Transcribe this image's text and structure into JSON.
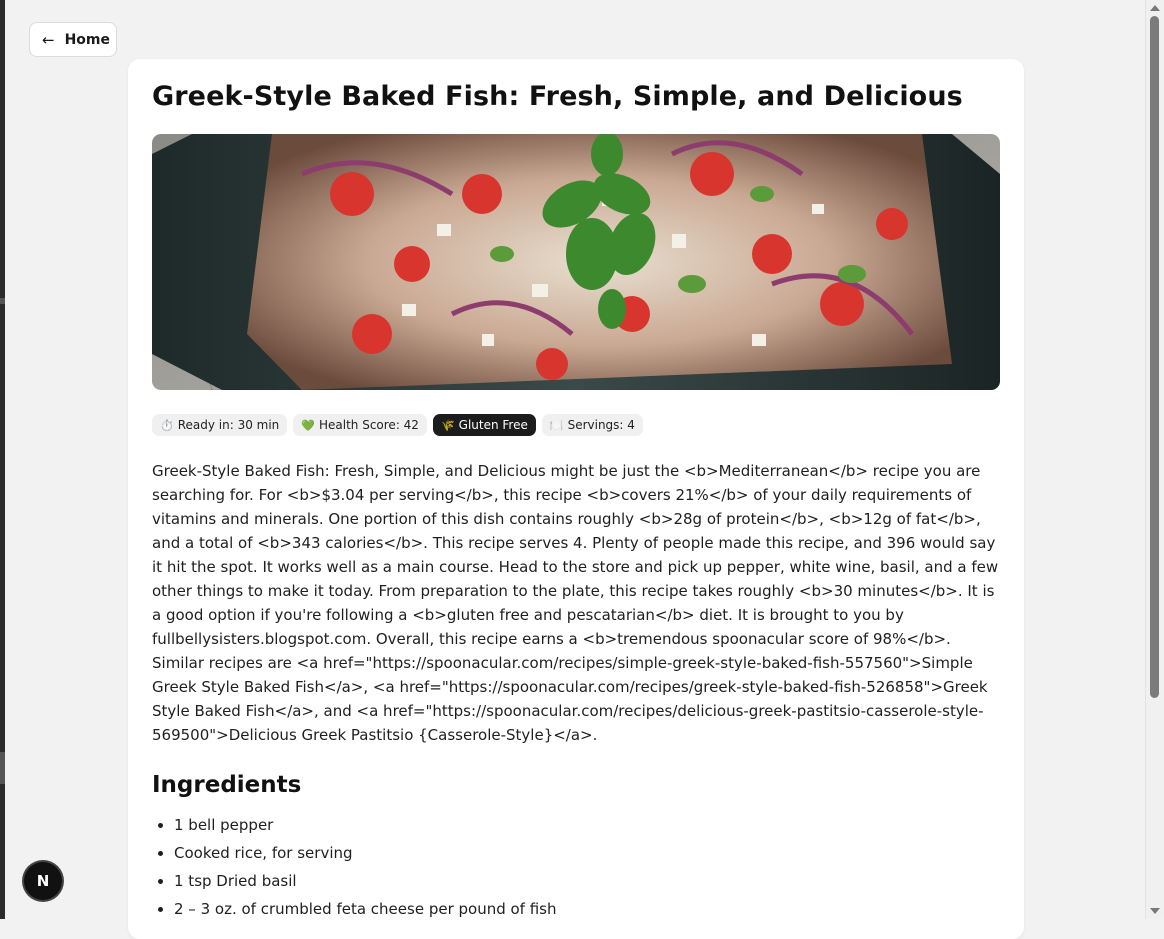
{
  "nav": {
    "home_label": "Home",
    "back_icon": "arrow-left-icon"
  },
  "recipe": {
    "title": "Greek-Style Baked Fish: Fresh, Simple, and Delicious",
    "image_alt": "Baked fish topped with tomatoes, red onion, feta and basil",
    "badges": [
      {
        "icon": "⏱️",
        "icon_name": "timer-icon",
        "label": "Ready in: 30 min",
        "dark": false
      },
      {
        "icon": "💚",
        "icon_name": "heart-icon",
        "label": "Health Score: 42",
        "dark": false
      },
      {
        "icon": "🌾",
        "icon_name": "wheat-icon",
        "label": "Gluten Free",
        "dark": true
      },
      {
        "icon": "🍽️",
        "icon_name": "plate-icon",
        "label": "Servings: 4",
        "dark": false
      }
    ],
    "summary": "Greek-Style Baked Fish: Fresh, Simple, and Delicious might be just the <b>Mediterranean</b> recipe you are searching for. For <b>$3.04 per serving</b>, this recipe <b>covers 21%</b> of your daily requirements of vitamins and minerals. One portion of this dish contains roughly <b>28g of protein</b>, <b>12g of fat</b>, and a total of <b>343 calories</b>. This recipe serves 4. Plenty of people made this recipe, and 396 would say it hit the spot. It works well as a main course. Head to the store and pick up pepper, white wine, basil, and a few other things to make it today. From preparation to the plate, this recipe takes roughly <b>30 minutes</b>. It is a good option if you're following a <b>gluten free and pescatarian</b> diet. It is brought to you by fullbellysisters.blogspot.com. Overall, this recipe earns a <b>tremendous spoonacular score of 98%</b>. Similar recipes are <a href=\"https://spoonacular.com/recipes/simple-greek-style-baked-fish-557560\">Simple Greek Style Baked Fish</a>, <a href=\"https://spoonacular.com/recipes/greek-style-baked-fish-526858\">Greek Style Baked Fish</a>, and <a href=\"https://spoonacular.com/recipes/delicious-greek-pastitsio-casserole-style-569500\">Delicious Greek Pastitsio {Casserole-Style}</a>.",
    "ingredients_heading": "Ingredients",
    "ingredients": [
      "1 bell pepper",
      "Cooked rice, for serving",
      "1 tsp Dried basil",
      "2 – 3 oz. of crumbled feta cheese per pound of fish"
    ]
  },
  "dev_badge": {
    "label": "N"
  },
  "colors": {
    "page_bg": "#f2f2f2",
    "card_bg": "#ffffff",
    "dark_badge": "#1c1c1c",
    "badge_bg": "#f0f0f0"
  }
}
